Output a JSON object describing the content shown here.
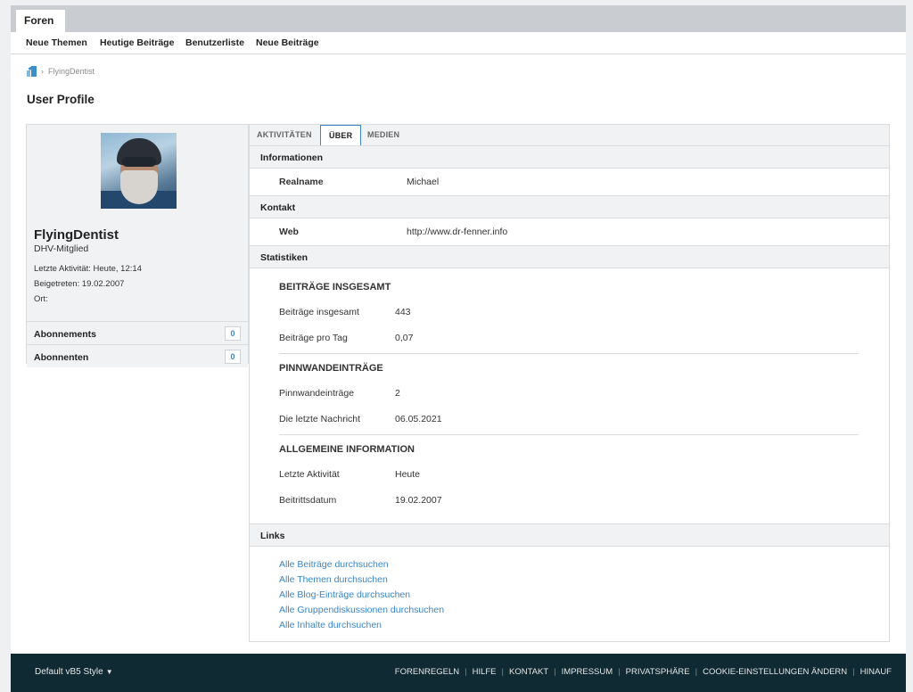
{
  "topbar": {
    "tab_label": "Foren"
  },
  "subnav": [
    "Neue Themen",
    "Heutige Beiträge",
    "Benutzerliste",
    "Neue Beiträge"
  ],
  "breadcrumb": {
    "current": "FlyingDentist"
  },
  "page_title": "User Profile",
  "profile": {
    "username": "FlyingDentist",
    "role": "DHV-Mitglied",
    "last_activity": "Letzte Aktivität: Heute, 12:14",
    "joined": "Beigetreten: 19.02.2007",
    "location": "Ort:",
    "subscriptions_label": "Abonnements",
    "subscriptions_count": "0",
    "subscribers_label": "Abonnenten",
    "subscribers_count": "0"
  },
  "tabs": {
    "activity": "AKTIVITÄTEN",
    "about": "ÜBER",
    "media": "MEDIEN"
  },
  "sections": {
    "info": "Informationen",
    "contact": "Kontakt",
    "stats": "Statistiken",
    "links": "Links"
  },
  "info": {
    "realname_label": "Realname",
    "realname_value": "Michael"
  },
  "contact": {
    "web_label": "Web",
    "web_value": "http://www.dr-fenner.info"
  },
  "stats": {
    "posts_heading": "BEITRÄGE INSGESAMT",
    "posts_total_label": "Beiträge insgesamt",
    "posts_total_value": "443",
    "posts_per_day_label": "Beiträge pro Tag",
    "posts_per_day_value": "0,07",
    "wall_heading": "PINNWANDEINTRÄGE",
    "wall_label": "Pinnwandeinträge",
    "wall_value": "2",
    "last_msg_label": "Die letzte Nachricht",
    "last_msg_value": "06.05.2021",
    "general_heading": "ALLGEMEINE INFORMATION",
    "last_activity_label": "Letzte Aktivität",
    "last_activity_value": "Heute",
    "join_date_label": "Beitrittsdatum",
    "join_date_value": "19.02.2007"
  },
  "links": [
    "Alle Beiträge durchsuchen",
    "Alle Themen durchsuchen",
    "Alle Blog-Einträge durchsuchen",
    "Alle Gruppendiskussionen durchsuchen",
    "Alle Inhalte durchsuchen"
  ],
  "footer": {
    "style_label": "Default vB5 Style",
    "links": [
      "FORENREGELN",
      "HILFE",
      "KONTAKT",
      "IMPRESSUM",
      "PRIVATSPHÄRE",
      "COOKIE-EINSTELLUNGEN ÄNDERN",
      "HINAUF"
    ]
  }
}
